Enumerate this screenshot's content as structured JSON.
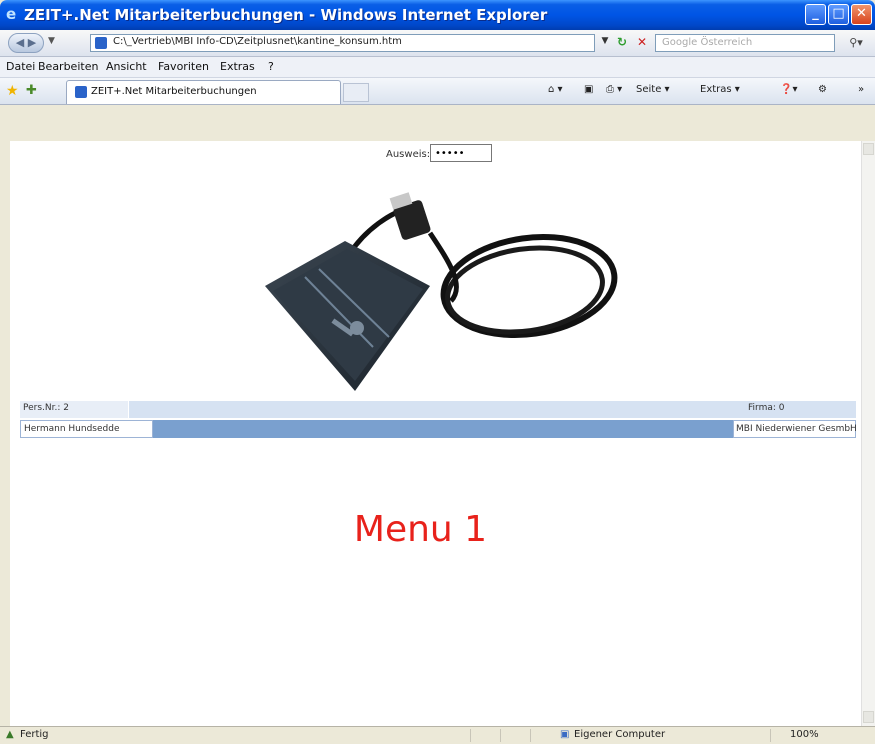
{
  "window": {
    "title": "ZEIT+.Net Mitarbeiterbuchungen - Windows Internet Explorer",
    "buttons": {
      "minimize": "_",
      "maximize": "□",
      "close": "✕"
    }
  },
  "addressbar": {
    "url": "C:\\_Vertrieb\\MBI Info-CD\\Zeitplusnet\\kantine_konsum.htm",
    "search_placeholder": "Google Österreich",
    "search_icon": "search-icon"
  },
  "menubar": {
    "items": [
      "Datei",
      "Bearbeiten",
      "Ansicht",
      "Favoriten",
      "Extras",
      "?"
    ]
  },
  "tabbar": {
    "tab_title": "ZEIT+.Net Mitarbeiterbuchungen",
    "commands": {
      "page": "Seite ▾",
      "tools": "Extras ▾"
    }
  },
  "content": {
    "ausweis_label": "Ausweis:",
    "ausweis_value": "•••••",
    "pers_nr": "Pers.Nr.: 2",
    "firma": "Firma: 0",
    "employee_name": "Hermann Hundsedde",
    "company_name": "MBI Niederwiener GesmbH",
    "menu_heading": "Menu 1"
  },
  "statusbar": {
    "status": "Fertig",
    "zone": "Eigener Computer",
    "zoom": "100%"
  },
  "colors": {
    "titlebar": "#0055e5",
    "heading_red": "#e8221b",
    "info_blue": "#7aa0cf"
  }
}
